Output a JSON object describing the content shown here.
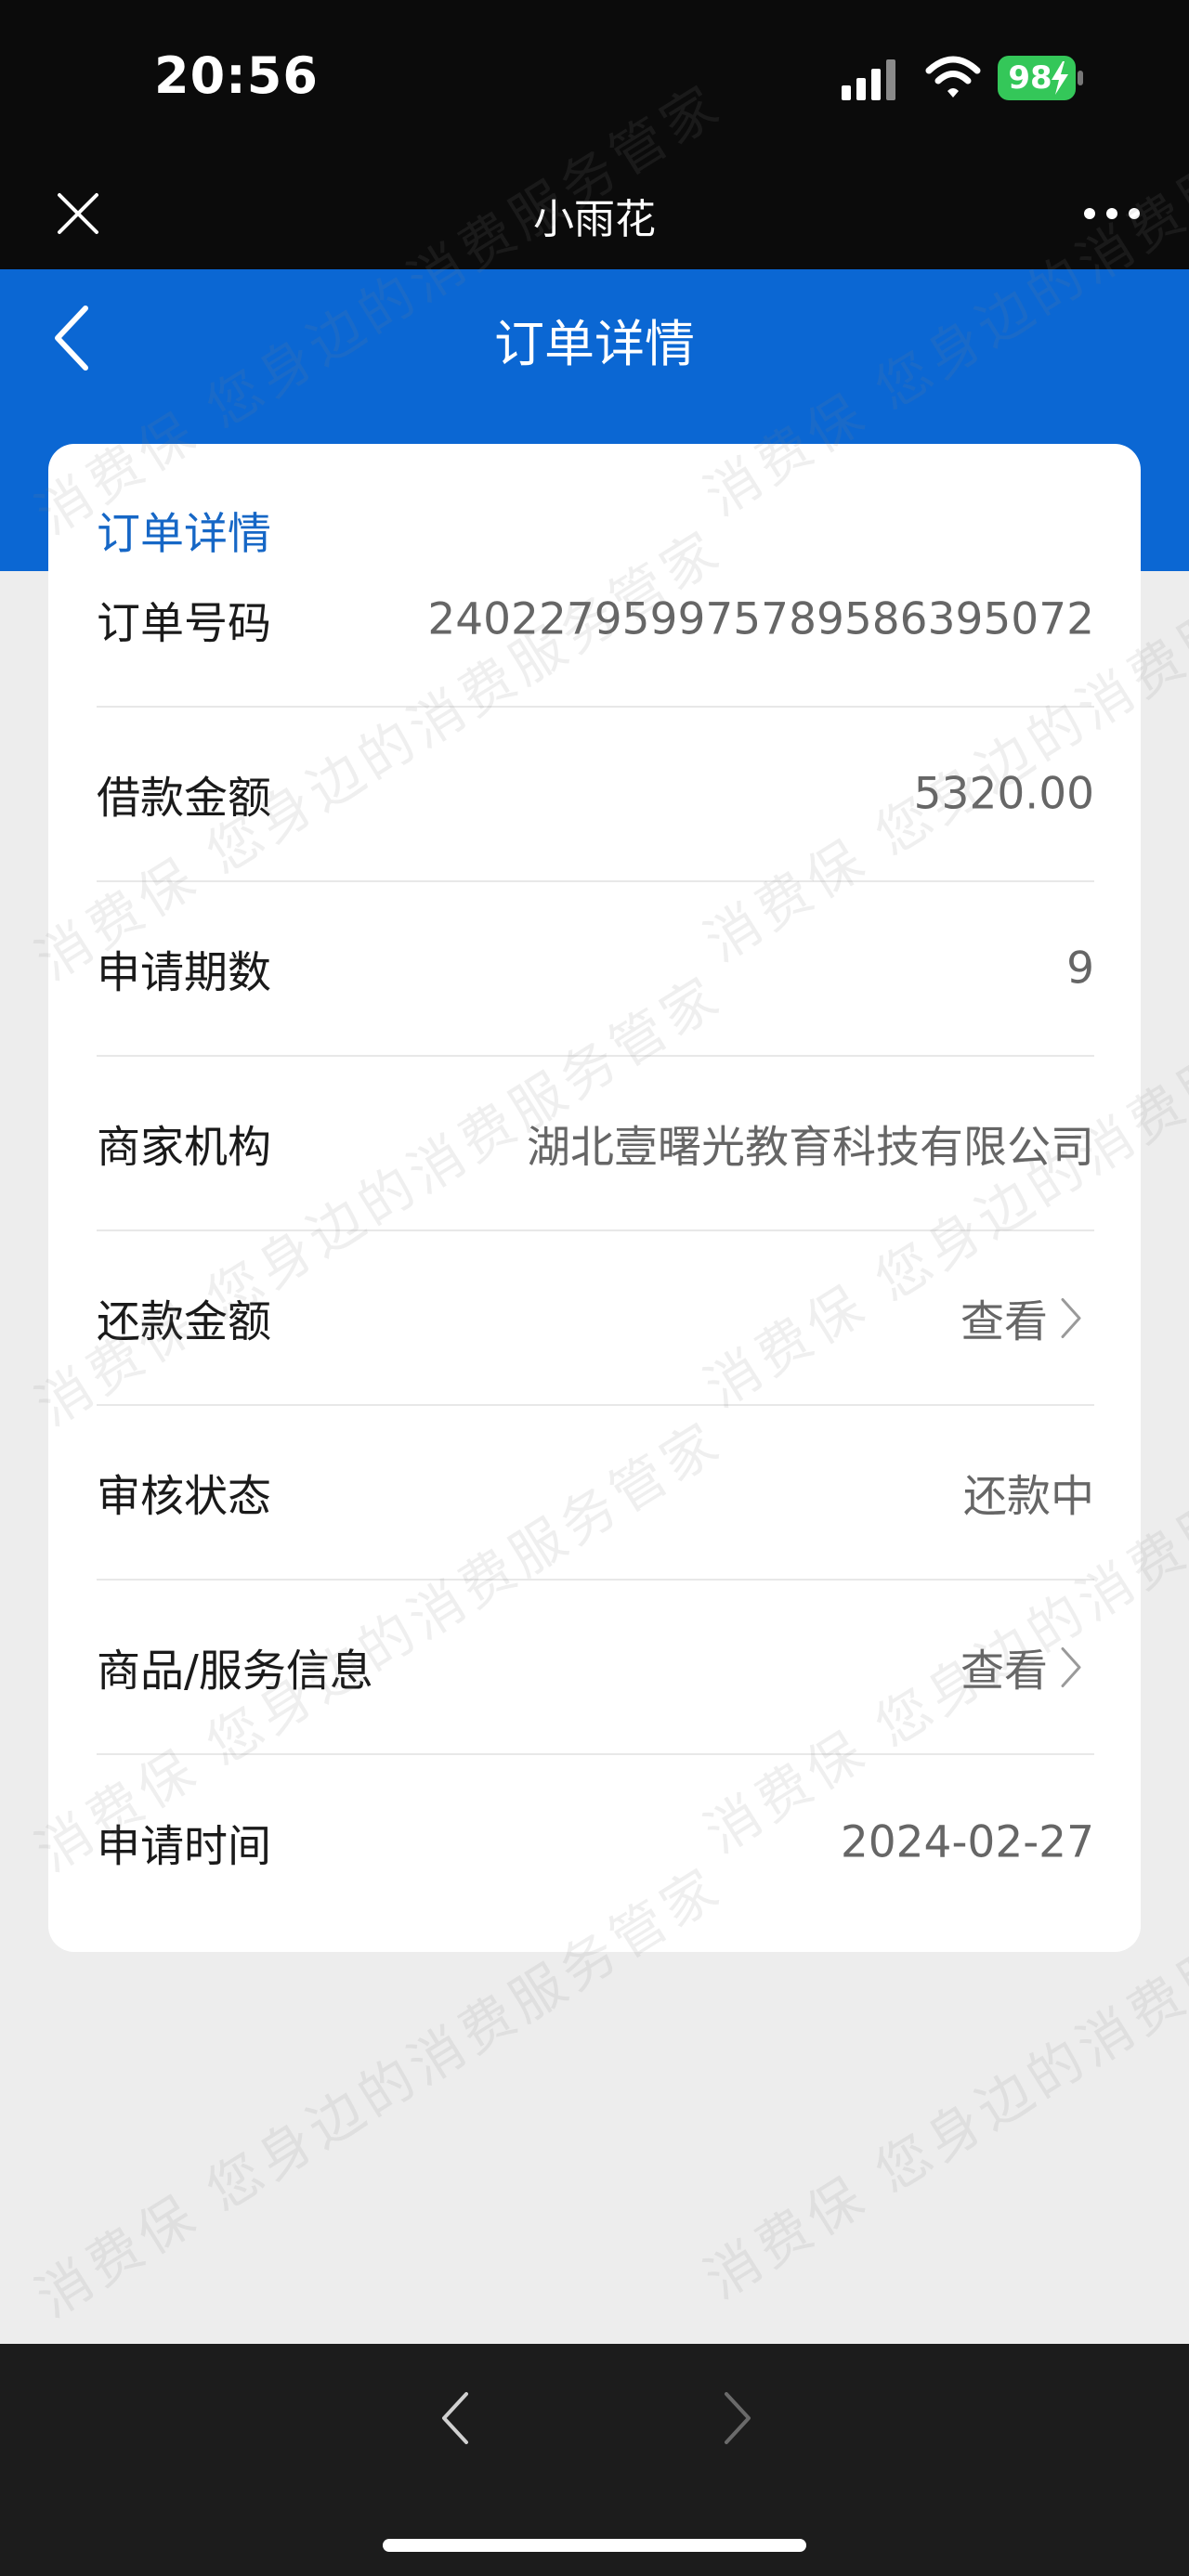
{
  "status_bar": {
    "time": "20:56",
    "battery": "98",
    "icons": [
      "signal-icon",
      "wifi-icon",
      "battery-charging-icon"
    ]
  },
  "app_header": {
    "title": "小雨花",
    "close_icon": "close-icon",
    "more_icon": "more-icon"
  },
  "nav": {
    "title": "订单详情",
    "back_icon": "back-icon"
  },
  "card": {
    "title": "订单详情",
    "rows": [
      {
        "label": "订单号码",
        "value": "240227959975789586395072"
      },
      {
        "label": "借款金额",
        "value": "5320.00"
      },
      {
        "label": "申请期数",
        "value": "9"
      },
      {
        "label": "商家机构",
        "value": "湖北壹曙光教育科技有限公司"
      },
      {
        "label": "还款金额",
        "value": "查看",
        "link": true
      },
      {
        "label": "审核状态",
        "value": "还款中"
      },
      {
        "label": "商品/服务信息",
        "value": "查看",
        "link": true
      },
      {
        "label": "申请时间",
        "value": "2024-02-27"
      }
    ]
  },
  "watermark": {
    "lines": [
      "消费保 您身边的消费服务管家",
      "消费保 您身边的消费服务管家"
    ]
  },
  "colors": {
    "primary_blue": "#0b67d3",
    "card_title_blue": "#1667c6",
    "battery_green": "#34c759",
    "background": "#ededed"
  }
}
